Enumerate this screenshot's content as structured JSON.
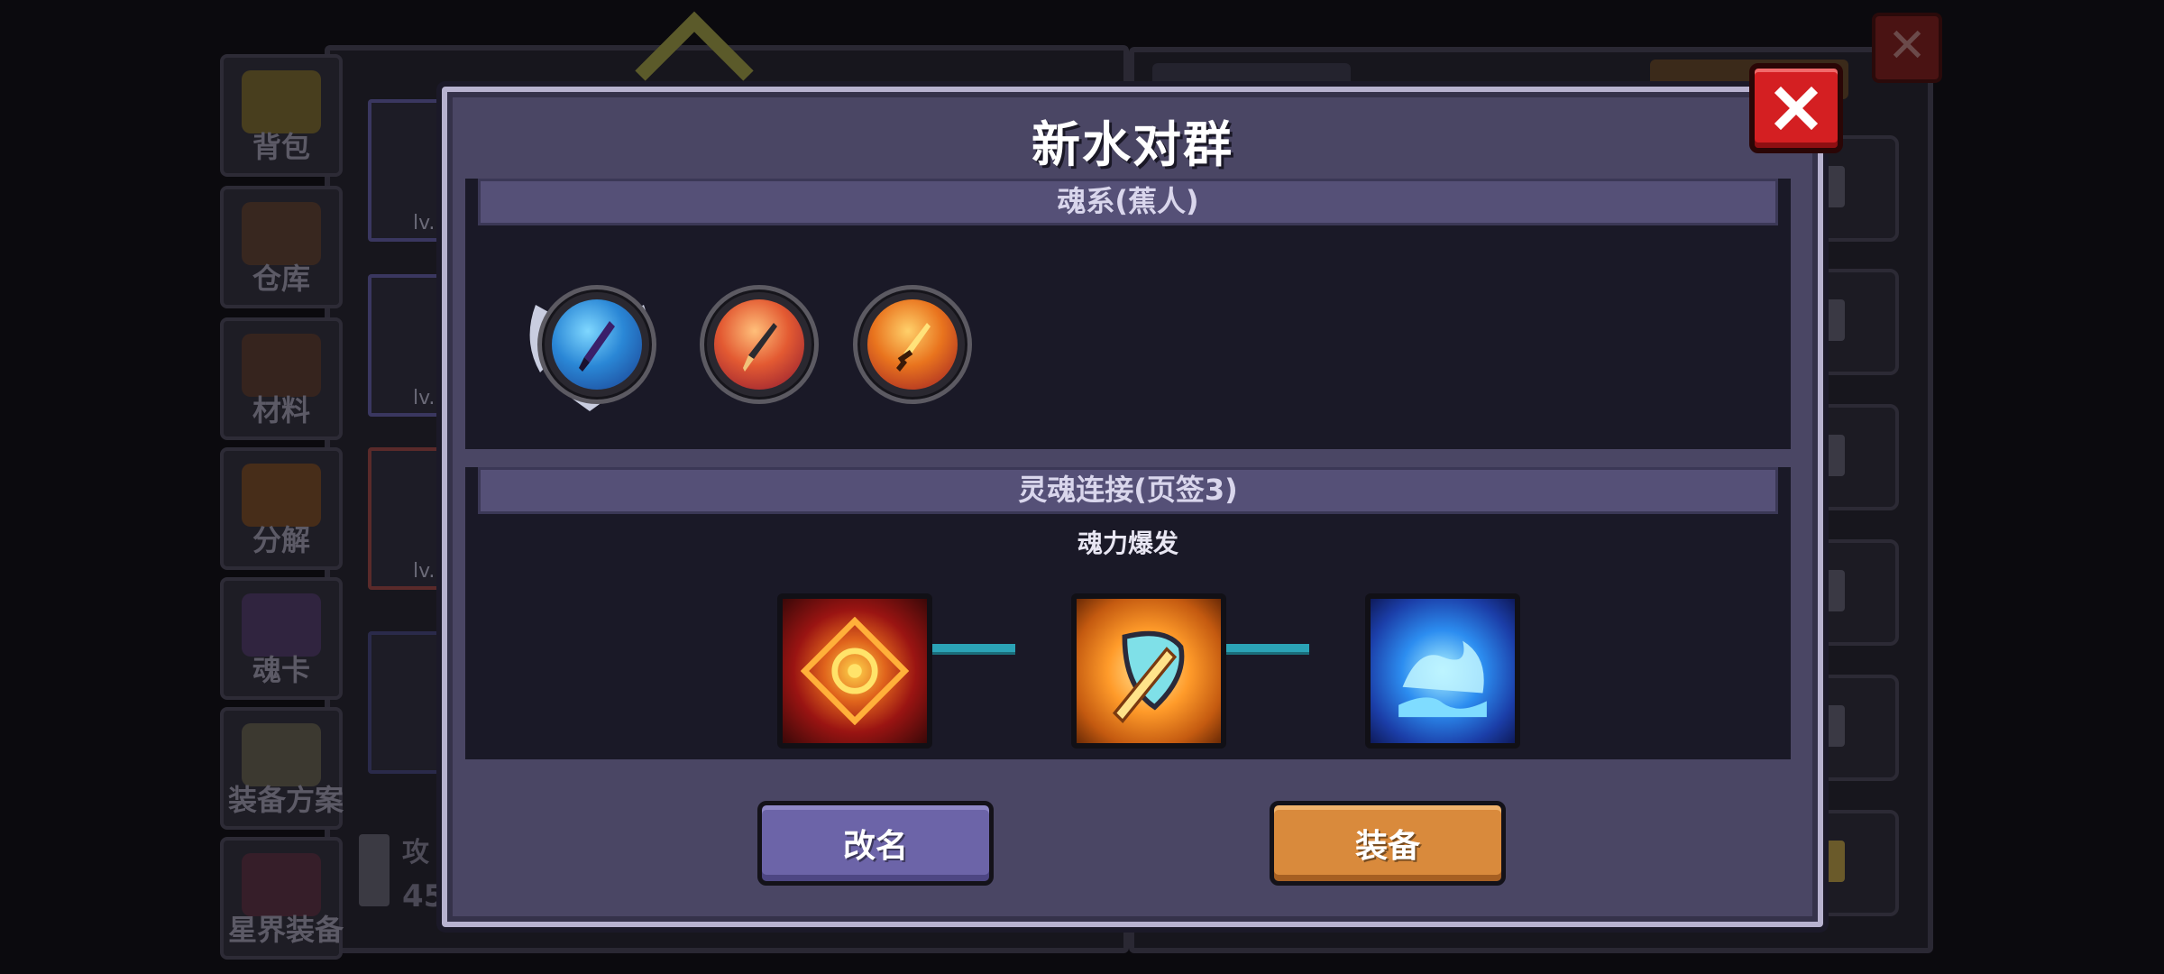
{
  "background": {
    "left_tabs": [
      "背包",
      "仓库",
      "材料",
      "分解",
      "魂卡",
      "装备方案",
      "星界装备"
    ],
    "card_caption": "lv.",
    "attack_label": "攻",
    "attack_value": "45",
    "close_icon": "close-icon"
  },
  "dialog": {
    "title": "新水对群",
    "soul_section": {
      "header": "魂系(蕉人)",
      "orbs": [
        {
          "icon": "blue-dagger-orb-icon"
        },
        {
          "icon": "flame-spear-orb-icon"
        },
        {
          "icon": "golden-sword-orb-icon"
        }
      ]
    },
    "link_section": {
      "header": "灵魂连接(页签3)",
      "active_label": "魂力爆发",
      "runes": [
        {
          "icon": "crimson-sigil-icon",
          "color": "#9a1412"
        },
        {
          "icon": "blade-shield-icon",
          "color": "#ff9b2a"
        },
        {
          "icon": "water-wave-icon",
          "color": "#2c8df0"
        }
      ]
    },
    "buttons": {
      "rename": "改名",
      "equip": "装备"
    },
    "close_icon": "close-icon"
  },
  "colors": {
    "dialog_bg": "#4a4664",
    "rename_button": "#6c64a8",
    "equip_button": "#d98a3c",
    "close_button": "#d41f22",
    "link_line": "#2ba3b6"
  }
}
